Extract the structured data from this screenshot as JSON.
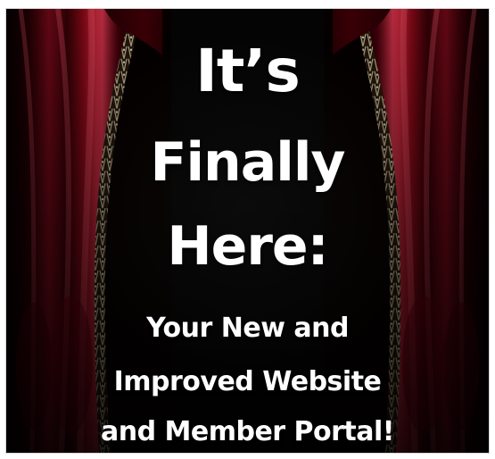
{
  "headline": {
    "line1": "It’s",
    "line2": "Finally",
    "line3": "Here:"
  },
  "subheadline": {
    "line1": "Your New and",
    "line2": "Improved Website",
    "line3": "and Member Portal!"
  },
  "colors": {
    "background": "#050505",
    "text": "#ffffff",
    "curtain_dark": "#5b0008",
    "curtain_mid": "#9b0012",
    "curtain_bright": "#e3152f",
    "fringe": "#c8b58b"
  },
  "icons": {
    "left_curtain": "stage-curtain-left-icon",
    "right_curtain": "stage-curtain-right-icon"
  }
}
